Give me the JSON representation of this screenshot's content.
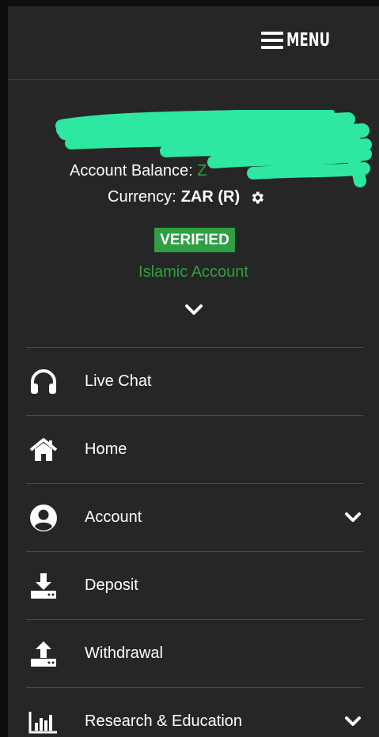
{
  "header": {
    "menu_label": "MENU"
  },
  "account": {
    "balance_label": "Account Balance:",
    "balance_value": "Z",
    "currency_label": "Currency:",
    "currency_value": "ZAR (R)",
    "status_badge": "VERIFIED",
    "account_type": "Islamic Account"
  },
  "nav": {
    "items": [
      {
        "label": "Live Chat",
        "icon": "headphones-icon",
        "has_submenu": false
      },
      {
        "label": "Home",
        "icon": "home-icon",
        "has_submenu": false
      },
      {
        "label": "Account",
        "icon": "user-circle-icon",
        "has_submenu": true
      },
      {
        "label": "Deposit",
        "icon": "download-tray-icon",
        "has_submenu": false
      },
      {
        "label": "Withdrawal",
        "icon": "upload-tray-icon",
        "has_submenu": false
      },
      {
        "label": "Research & Education",
        "icon": "bar-chart-icon",
        "has_submenu": true
      }
    ]
  },
  "colors": {
    "background": "#262626",
    "accent_green": "#2ea043",
    "redaction_mark": "#2ee8a2",
    "text": "#ffffff"
  }
}
